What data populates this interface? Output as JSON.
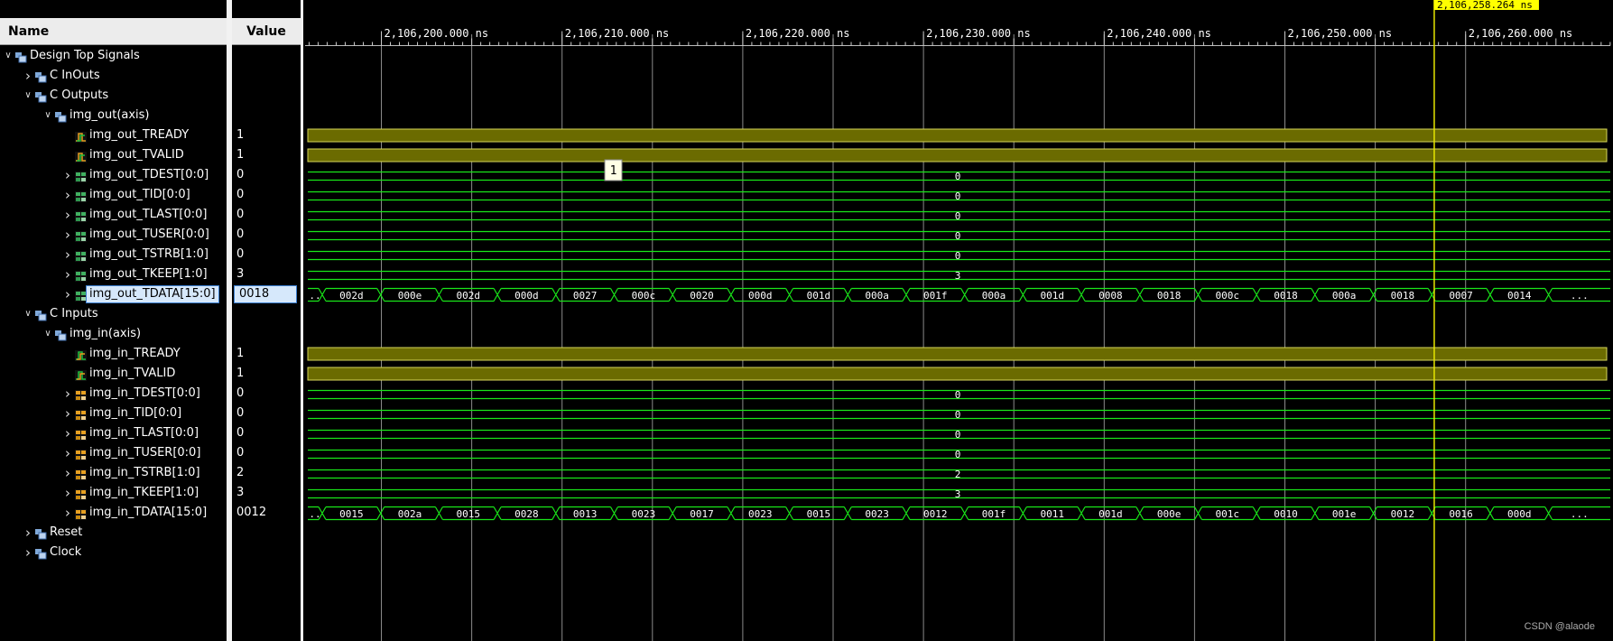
{
  "header": {
    "name_col": "Name",
    "value_col": "Value"
  },
  "cursor": {
    "time": "2,106,258.264 ns"
  },
  "time_axis": {
    "labels": [
      "2,106,200.000 ns",
      "2,106,210.000 ns",
      "2,106,220.000 ns",
      "2,106,230.000 ns",
      "2,106,240.000 ns",
      "2,106,250.000 ns",
      "2,106,260.000 ns"
    ]
  },
  "tooltip": "1",
  "tree": [
    {
      "label": "Design Top Signals",
      "value": "",
      "depth": 0,
      "expander": "expanded",
      "icon": "scope",
      "wave": "none"
    },
    {
      "label": "C InOuts",
      "value": "",
      "depth": 1,
      "expander": "collapsed",
      "icon": "scope",
      "wave": "none"
    },
    {
      "label": "C Outputs",
      "value": "",
      "depth": 1,
      "expander": "expanded",
      "icon": "scope",
      "wave": "none"
    },
    {
      "label": "img_out(axis)",
      "value": "",
      "depth": 2,
      "expander": "expanded",
      "icon": "scope",
      "wave": "none"
    },
    {
      "label": "img_out_TREADY",
      "value": "1",
      "depth": 3,
      "expander": "none",
      "icon": "bit-out",
      "wave": "high"
    },
    {
      "label": "img_out_TVALID",
      "value": "1",
      "depth": 3,
      "expander": "none",
      "icon": "bit-out",
      "wave": "high"
    },
    {
      "label": "img_out_TDEST[0:0]",
      "value": "0",
      "depth": 3,
      "expander": "collapsed",
      "icon": "bus-out",
      "wave": "const",
      "const": "0"
    },
    {
      "label": "img_out_TID[0:0]",
      "value": "0",
      "depth": 3,
      "expander": "collapsed",
      "icon": "bus-out",
      "wave": "const",
      "const": "0"
    },
    {
      "label": "img_out_TLAST[0:0]",
      "value": "0",
      "depth": 3,
      "expander": "collapsed",
      "icon": "bus-out",
      "wave": "const",
      "const": "0"
    },
    {
      "label": "img_out_TUSER[0:0]",
      "value": "0",
      "depth": 3,
      "expander": "collapsed",
      "icon": "bus-out",
      "wave": "const",
      "const": "0"
    },
    {
      "label": "img_out_TSTRB[1:0]",
      "value": "0",
      "depth": 3,
      "expander": "collapsed",
      "icon": "bus-out",
      "wave": "const",
      "const": "0"
    },
    {
      "label": "img_out_TKEEP[1:0]",
      "value": "3",
      "depth": 3,
      "expander": "collapsed",
      "icon": "bus-out",
      "wave": "const",
      "const": "3"
    },
    {
      "label": "img_out_TDATA[15:0]",
      "value": "0018",
      "depth": 3,
      "expander": "collapsed",
      "icon": "bus-out",
      "wave": "bus",
      "selected": true,
      "segments": [
        "002d",
        "000e",
        "002d",
        "000d",
        "0027",
        "000c",
        "0020",
        "000d",
        "001d",
        "000a",
        "001f",
        "000a",
        "001d",
        "0008",
        "0018",
        "000c",
        "0018",
        "000a",
        "0018",
        "0007",
        "0014"
      ]
    },
    {
      "label": "C Inputs",
      "value": "",
      "depth": 1,
      "expander": "expanded",
      "icon": "scope",
      "wave": "none"
    },
    {
      "label": "img_in(axis)",
      "value": "",
      "depth": 2,
      "expander": "expanded",
      "icon": "scope",
      "wave": "none"
    },
    {
      "label": "img_in_TREADY",
      "value": "1",
      "depth": 3,
      "expander": "none",
      "icon": "bit-in",
      "wave": "high"
    },
    {
      "label": "img_in_TVALID",
      "value": "1",
      "depth": 3,
      "expander": "none",
      "icon": "bit-in",
      "wave": "high"
    },
    {
      "label": "img_in_TDEST[0:0]",
      "value": "0",
      "depth": 3,
      "expander": "collapsed",
      "icon": "bus-in",
      "wave": "const",
      "const": "0"
    },
    {
      "label": "img_in_TID[0:0]",
      "value": "0",
      "depth": 3,
      "expander": "collapsed",
      "icon": "bus-in",
      "wave": "const",
      "const": "0"
    },
    {
      "label": "img_in_TLAST[0:0]",
      "value": "0",
      "depth": 3,
      "expander": "collapsed",
      "icon": "bus-in",
      "wave": "const",
      "const": "0"
    },
    {
      "label": "img_in_TUSER[0:0]",
      "value": "0",
      "depth": 3,
      "expander": "collapsed",
      "icon": "bus-in",
      "wave": "const",
      "const": "0"
    },
    {
      "label": "img_in_TSTRB[1:0]",
      "value": "2",
      "depth": 3,
      "expander": "collapsed",
      "icon": "bus-in",
      "wave": "const",
      "const": "2"
    },
    {
      "label": "img_in_TKEEP[1:0]",
      "value": "3",
      "depth": 3,
      "expander": "collapsed",
      "icon": "bus-in",
      "wave": "const",
      "const": "3"
    },
    {
      "label": "img_in_TDATA[15:0]",
      "value": "0012",
      "depth": 3,
      "expander": "collapsed",
      "icon": "bus-in",
      "wave": "bus",
      "segments": [
        "0015",
        "002a",
        "0015",
        "0028",
        "0013",
        "0023",
        "0017",
        "0023",
        "0015",
        "0023",
        "0012",
        "001f",
        "0011",
        "001d",
        "000e",
        "001c",
        "0010",
        "001e",
        "0012",
        "0016",
        "000d"
      ]
    },
    {
      "label": "Reset",
      "value": "",
      "depth": 1,
      "expander": "collapsed",
      "icon": "scope",
      "wave": "none"
    },
    {
      "label": "Clock",
      "value": "",
      "depth": 1,
      "expander": "collapsed",
      "icon": "scope",
      "wave": "none"
    }
  ],
  "bus_overflow_marker": "..",
  "colors": {
    "background": "#000000",
    "wave_green": "#19e619",
    "high_fill": "#6b6b00",
    "high_stroke": "#d6d65a",
    "cursor": "#e6e600",
    "grid": "#8a8a8a"
  },
  "watermark": "CSDN @alaode"
}
